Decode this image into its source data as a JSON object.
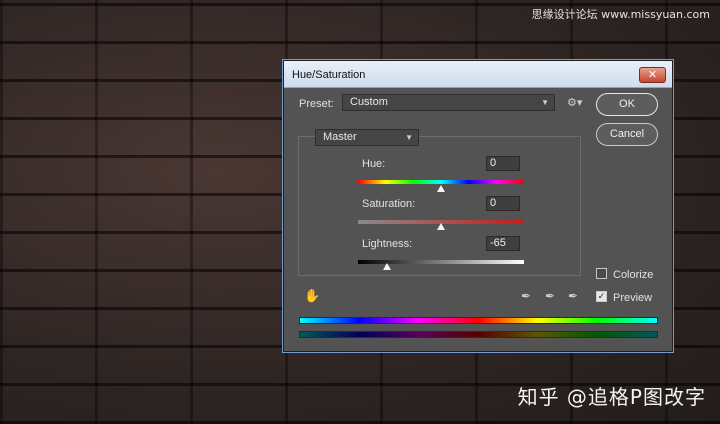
{
  "watermark_top": "思缘设计论坛 www.missyuan.com",
  "watermark_bottom": "知乎 @追格P图改字",
  "dialog": {
    "title": "Hue/Saturation",
    "close_label": "✕",
    "preset_label": "Preset:",
    "preset_value": "Custom",
    "ok_label": "OK",
    "cancel_label": "Cancel",
    "channel_value": "Master",
    "hue_label": "Hue:",
    "hue_value": "0",
    "saturation_label": "Saturation:",
    "saturation_value": "0",
    "lightness_label": "Lightness:",
    "lightness_value": "-65",
    "colorize_label": "Colorize",
    "colorize_checked": false,
    "preview_label": "Preview",
    "preview_checked": true,
    "icons": {
      "preset_options": "gear-icon",
      "target_adjust": "hand-target-icon",
      "eyedropper": "eyedropper-icon",
      "eyedropper_add": "eyedropper-plus-icon",
      "eyedropper_subtract": "eyedropper-minus-icon"
    },
    "slider_fraction": {
      "hue": 0.5,
      "saturation": 0.5,
      "lightness": 0.175
    }
  }
}
